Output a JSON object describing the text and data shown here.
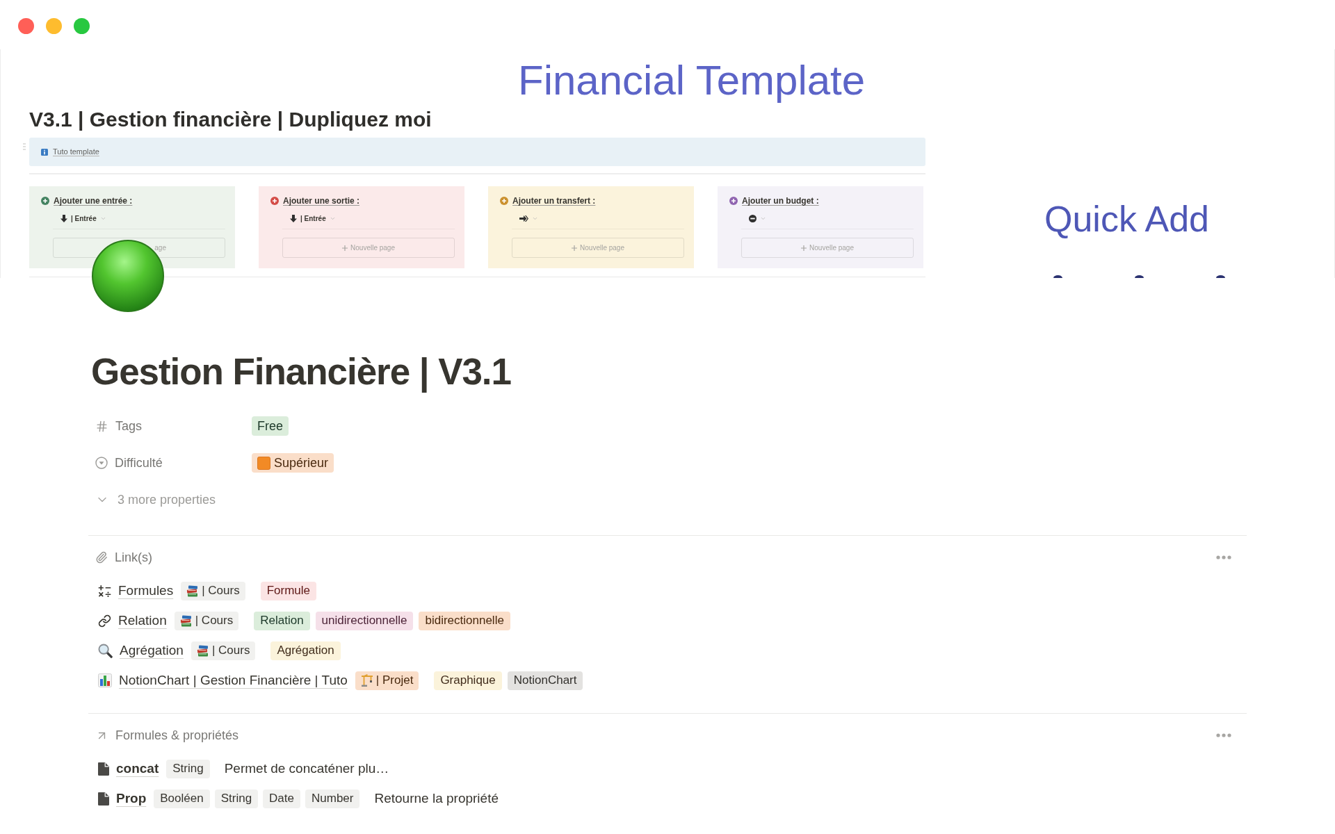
{
  "cover": {
    "heading": "Financial Template",
    "page_title": "V3.1 | Gestion financière | Dupliquez moi",
    "callout": "Tuto template",
    "cards": [
      {
        "kind": "income",
        "color": "#edf3ec",
        "title": "Ajouter une entrée :",
        "select": "| Entrée",
        "new_page": "age",
        "new_page_covered": true
      },
      {
        "kind": "expense",
        "color": "#fbeaea",
        "title": "Ajouter une sortie :",
        "select": "| Entrée",
        "new_page": "Nouvelle page",
        "new_page_covered": false
      },
      {
        "kind": "transfer",
        "color": "#fbf3dc",
        "title": "Ajouter un transfert :",
        "new_page": "Nouvelle page",
        "new_page_covered": false
      },
      {
        "kind": "budget",
        "color": "#f4f2f8",
        "title": "Ajouter un budget :",
        "new_page": "Nouvelle page",
        "new_page_covered": false
      }
    ],
    "side_heading": "Quick Add"
  },
  "page": {
    "title": "Gestion Financière | V3.1",
    "properties": [
      {
        "kind": "multi_select",
        "name": "Tags",
        "values": [
          {
            "kind": "plain",
            "label": "Free",
            "color": "#dbeddb"
          }
        ]
      },
      {
        "kind": "select",
        "name": "Difficulté",
        "values": [
          {
            "kind": "marked",
            "label": "Supérieur",
            "color": "#fadec9"
          }
        ]
      }
    ],
    "more_properties": {
      "label": "3 more properties",
      "expanded": false
    },
    "sections": [
      {
        "kind": "links",
        "heading": "Link(s)",
        "rows": [
          {
            "kind": "formula",
            "title": "Formules",
            "relation": {
              "kind": "course",
              "label": "| Cours",
              "color": "#f1f1ef"
            },
            "tags": [
              {
                "label": "Formule",
                "color": "#fbe4e4"
              }
            ]
          },
          {
            "kind": "link",
            "title": "Relation",
            "relation": {
              "kind": "course",
              "label": "| Cours",
              "color": "#f1f1ef"
            },
            "tags": [
              {
                "label": "Relation",
                "color": "#dbeddb"
              },
              {
                "label": "unidirectionnelle",
                "color": "#f5e0e9"
              },
              {
                "label": "bidirectionnelle",
                "color": "#fadec9"
              }
            ]
          },
          {
            "kind": "search",
            "title": "Agrégation",
            "relation": {
              "kind": "course",
              "label": "| Cours",
              "color": "#f1f1ef"
            },
            "tags": [
              {
                "label": "Agrégation",
                "color": "#fbf3db"
              }
            ]
          },
          {
            "kind": "chart",
            "title": "NotionChart | Gestion Financière | Tuto",
            "relation": {
              "kind": "project",
              "label": "| Projet",
              "color": "#fadec9"
            },
            "tags": [
              {
                "label": "Graphique",
                "color": "#fbf3db"
              },
              {
                "label": "NotionChart",
                "color": "#e3e2e0"
              }
            ]
          }
        ]
      },
      {
        "kind": "formulas",
        "heading": "Formules & propriétés",
        "rows": [
          {
            "kind": "page",
            "title": "concat",
            "tags": [
              {
                "label": "String"
              }
            ],
            "description": "Permet de concaténer plu…"
          },
          {
            "kind": "page",
            "title": "Prop",
            "tags": [
              {
                "label": "Booléen"
              },
              {
                "label": "String"
              },
              {
                "label": "Date"
              },
              {
                "label": "Number"
              }
            ],
            "description": "Retourne la propriété"
          }
        ]
      }
    ]
  }
}
